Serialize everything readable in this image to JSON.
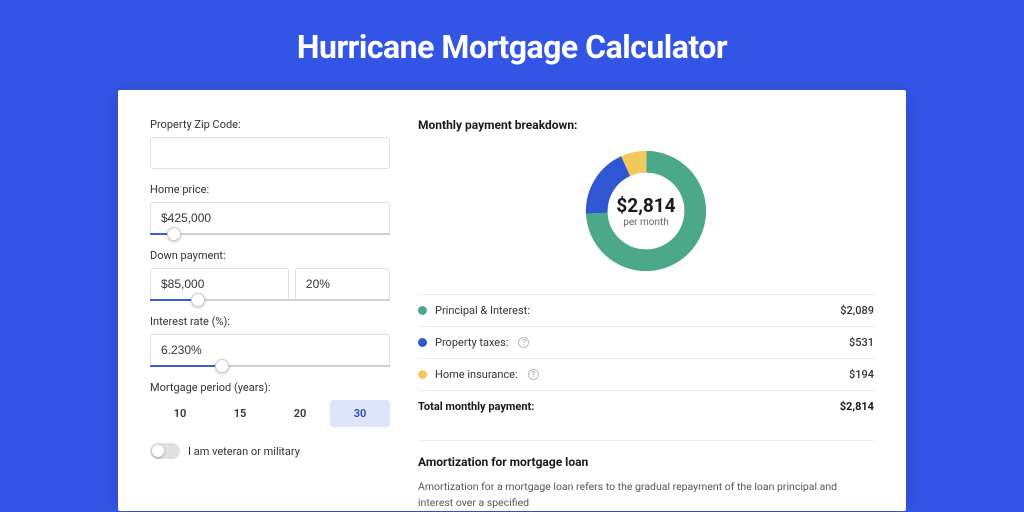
{
  "title": "Hurricane Mortgage Calculator",
  "form": {
    "zip": {
      "label": "Property Zip Code:",
      "value": ""
    },
    "home_price": {
      "label": "Home price:",
      "value": "$425,000",
      "slider_pct": 10
    },
    "down_payment": {
      "label": "Down payment:",
      "value": "$85,000",
      "pct": "20%",
      "slider_pct": 20
    },
    "interest_rate": {
      "label": "Interest rate (%):",
      "value": "6.230%",
      "slider_pct": 30
    },
    "period": {
      "label": "Mortgage period (years):",
      "options": [
        "10",
        "15",
        "20",
        "30"
      ],
      "selected": "30"
    },
    "veteran": {
      "label": "I am veteran or military",
      "checked": false
    }
  },
  "breakdown": {
    "title": "Monthly payment breakdown:",
    "total_amount": "$2,814",
    "per_month": "per month",
    "rows": [
      {
        "key": "principal",
        "label": "Principal & Interest:",
        "value": "$2,089",
        "color": "green",
        "info": false
      },
      {
        "key": "taxes",
        "label": "Property taxes:",
        "value": "$531",
        "color": "blue",
        "info": true
      },
      {
        "key": "insurance",
        "label": "Home insurance:",
        "value": "$194",
        "color": "yellow",
        "info": true
      }
    ],
    "total_row": {
      "label": "Total monthly payment:",
      "value": "$2,814"
    }
  },
  "amortization": {
    "title": "Amortization for mortgage loan",
    "text": "Amortization for a mortgage loan refers to the gradual repayment of the loan principal and interest over a specified"
  },
  "chart_data": {
    "type": "pie",
    "title": "Monthly payment breakdown",
    "series": [
      {
        "name": "Principal & Interest",
        "value": 2089,
        "color": "#4ba98a"
      },
      {
        "name": "Property taxes",
        "value": 531,
        "color": "#3056d3"
      },
      {
        "name": "Home insurance",
        "value": 194,
        "color": "#f0c95a"
      }
    ],
    "total": 2814,
    "center_label": "$2,814",
    "center_sub": "per month"
  }
}
